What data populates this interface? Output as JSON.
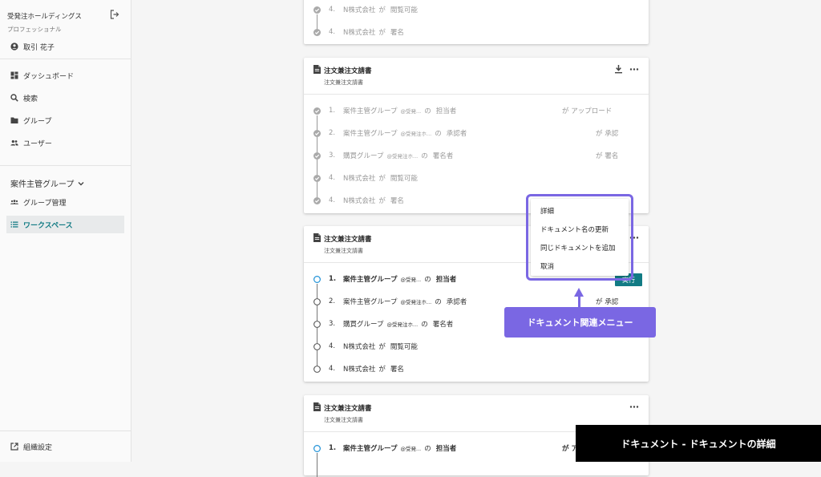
{
  "sidebar": {
    "org_name": "受発注ホールディングス",
    "plan": "プロフェッショナル",
    "user": "取引 花子",
    "nav": [
      "ダッシュボード",
      "検索",
      "グループ",
      "ユーザー"
    ],
    "group_name": "案件主管グループ",
    "group_nav": [
      "グループ管理",
      "ワークスペース"
    ],
    "settings": "組織設定"
  },
  "card0": {
    "steps": [
      {
        "num": "4.",
        "group": "N株式会社",
        "conn": "が",
        "role": "閲覧可能"
      },
      {
        "num": "4.",
        "group": "N株式会社",
        "conn": "が",
        "role": "署名"
      }
    ]
  },
  "card1": {
    "title": "注文兼注文請書",
    "subtitle": "注文兼注文請書",
    "steps": [
      {
        "num": "1.",
        "group": "案件主管グループ",
        "org": "@受発...",
        "conn": "の",
        "role": "担当者",
        "right": "が アップロード"
      },
      {
        "num": "2.",
        "group": "案件主管グループ",
        "org": "@受発注ホ...",
        "conn": "の",
        "role": "承認者",
        "right": "が 承認"
      },
      {
        "num": "3.",
        "group": "購買グループ",
        "org": "@受発注ホ...",
        "conn": "の",
        "role": "署名者",
        "right": "が 署名"
      },
      {
        "num": "4.",
        "group": "N株式会社",
        "org": "",
        "conn": "が",
        "role": "閲覧可能",
        "right": ""
      },
      {
        "num": "4.",
        "group": "N株式会社",
        "org": "",
        "conn": "が",
        "role": "署名",
        "right": ""
      }
    ]
  },
  "card2": {
    "title": "注文兼注文請書",
    "subtitle": "注文兼注文請書",
    "run_button": "実行",
    "steps": [
      {
        "num": "1.",
        "group": "案件主管グループ",
        "org": "@受発...",
        "conn": "の",
        "role": "担当者",
        "right": ""
      },
      {
        "num": "2.",
        "group": "案件主管グループ",
        "org": "@受発注ホ...",
        "conn": "の",
        "role": "承認者",
        "right": "が 承認"
      },
      {
        "num": "3.",
        "group": "購買グループ",
        "org": "@受発注ホ...",
        "conn": "の",
        "role": "署名者",
        "right": ""
      },
      {
        "num": "4.",
        "group": "N株式会社",
        "org": "",
        "conn": "が",
        "role": "閲覧可能",
        "right": ""
      },
      {
        "num": "4.",
        "group": "N株式会社",
        "org": "",
        "conn": "が",
        "role": "署名",
        "right": ""
      }
    ]
  },
  "card3": {
    "title": "注文兼注文請書",
    "subtitle": "注文兼注文請書",
    "steps": [
      {
        "num": "1.",
        "group": "案件主管グループ",
        "org": "@受発...",
        "conn": "の",
        "role": "担当者",
        "right": "が ア"
      }
    ]
  },
  "context_menu": {
    "items": [
      "詳細",
      "ドキュメント名の更新",
      "同じドキュメントを追加",
      "取消"
    ]
  },
  "callout": "ドキュメント関連メニュー",
  "caption": "ドキュメント - ドキュメントの詳細",
  "colors": {
    "accent": "#127b84",
    "highlight": "#7a67e3"
  }
}
